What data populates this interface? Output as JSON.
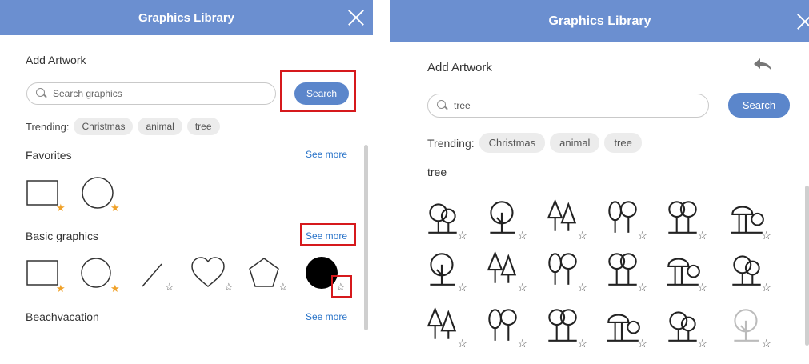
{
  "left": {
    "header": {
      "title": "Graphics Library"
    },
    "add_artwork": "Add Artwork",
    "search": {
      "placeholder": "Search graphics",
      "button": "Search"
    },
    "trending": {
      "label": "Trending:",
      "chips": [
        "Christmas",
        "animal",
        "tree"
      ]
    },
    "sections": [
      {
        "title": "Favorites",
        "see_more": "See more"
      },
      {
        "title": "Basic graphics",
        "see_more": "See more"
      },
      {
        "title": "Beachvacation",
        "see_more": "See more"
      }
    ]
  },
  "right": {
    "header": {
      "title": "Graphics Library"
    },
    "add_artwork": "Add Artwork",
    "search": {
      "value": "tree",
      "button": "Search"
    },
    "trending": {
      "label": "Trending:",
      "chips": [
        "Christmas",
        "animal",
        "tree"
      ]
    },
    "results_title": "tree",
    "icons": [
      "tree-icon",
      "star-icon",
      "back-arrow-icon",
      "close-icon",
      "search-icon"
    ]
  },
  "colors": {
    "header": "#6b8fd0",
    "button": "#5b86cb",
    "link": "#2a74c9",
    "favorite_star": "#f0a22a",
    "highlight": "#d6191c"
  }
}
